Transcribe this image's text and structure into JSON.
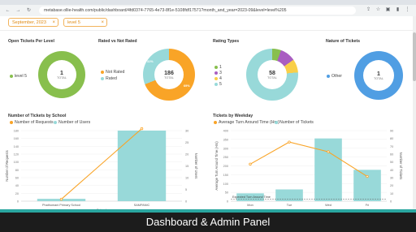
{
  "browser": {
    "url": "metabase.ollie-health.com/public/dashboard/4fd0374-7765-4e73-8f1e-5108fdf17571?month_and_year=2023-09&level=level%205"
  },
  "filters": {
    "month": "September, 2023",
    "level": "level 5"
  },
  "charts": {
    "open_tickets": {
      "title": "Open Tickets Per Level",
      "legend": [
        "level 5"
      ],
      "total": "1",
      "total_label": "TOTAL",
      "colors": {
        "level 5": "#88bf4d"
      }
    },
    "rated": {
      "title": "Rated vs Not Rated",
      "legend": [
        "Not Rated",
        "Rated"
      ],
      "total": "186",
      "total_label": "TOTAL",
      "pct_labels": [
        "31%",
        "69%"
      ],
      "colors": {
        "not_rated": "#f9a427",
        "rated": "#98d9d9"
      }
    },
    "rating_types": {
      "title": "Rating Types",
      "legend": [
        "1",
        "3",
        "4",
        "5"
      ],
      "total": "58",
      "total_label": "TOTAL",
      "colors": {
        "1": "#88bf4d",
        "3": "#a95ec1",
        "4": "#f9cf48",
        "5": "#98d9d9"
      }
    },
    "nature": {
      "title": "Nature of Tickets",
      "legend": [
        "Other"
      ],
      "total": "1",
      "total_label": "TOTAL",
      "colors": {
        "Other": "#509ee3"
      }
    },
    "by_school": {
      "title": "Number of Tickets by School",
      "legend": [
        "Number of Requests",
        "Number of Users"
      ],
      "ylabel_left": "Number of Requests",
      "ylabel_right": "Number of Users",
      "y_ticks_left": [
        "0",
        "20",
        "40",
        "60",
        "80",
        "100",
        "120",
        "140",
        "160",
        "180"
      ],
      "y_ticks_right": [
        "0",
        "5",
        "10",
        "15",
        "20",
        "25",
        "30"
      ],
      "categories": [
        "Phathomani Primary School",
        "SAMPANIC"
      ],
      "xlabel": "School",
      "colors": {
        "requests": "#f9a427",
        "users": "#98d9d9"
      }
    },
    "by_weekday": {
      "title": "Tickets by Weekday",
      "legend": [
        "Average Turn Around Time (Hrs)",
        "Number of Tickets"
      ],
      "ylabel_left": "Average Turn Around Time (Hrs)",
      "ylabel_right": "Number of Tickets",
      "y_ticks_left": [
        "0",
        "50",
        "100",
        "150",
        "200",
        "250",
        "300",
        "350",
        "400"
      ],
      "y_ticks_right": [
        "0",
        "10",
        "20",
        "30",
        "40",
        "50",
        "60",
        "70",
        "80",
        "90"
      ],
      "categories": [
        "Mon",
        "Tue",
        "Wed",
        "Fri"
      ],
      "expected_label": "Expected Turn Around Time",
      "colors": {
        "tat": "#f9a427",
        "tickets": "#98d9d9"
      }
    }
  },
  "chart_data": [
    {
      "type": "bar",
      "title": "Number of Tickets by School",
      "categories": [
        "Phathomani Primary School",
        "SAMPANIC"
      ],
      "series": [
        {
          "name": "Number of Users",
          "values": [
            1,
            30
          ]
        },
        {
          "name": "Number of Requests",
          "values": [
            5,
            185
          ]
        }
      ]
    },
    {
      "type": "bar",
      "title": "Tickets by Weekday",
      "categories": [
        "Mon",
        "Tue",
        "Wed",
        "Fri"
      ],
      "series": [
        {
          "name": "Number of Tickets",
          "values": [
            10,
            15,
            80,
            40
          ]
        },
        {
          "name": "Average Turn Around Time (Hrs)",
          "values": [
            210,
            335,
            280,
            140
          ]
        }
      ]
    }
  ],
  "caption": "Dashboard & Admin Panel"
}
